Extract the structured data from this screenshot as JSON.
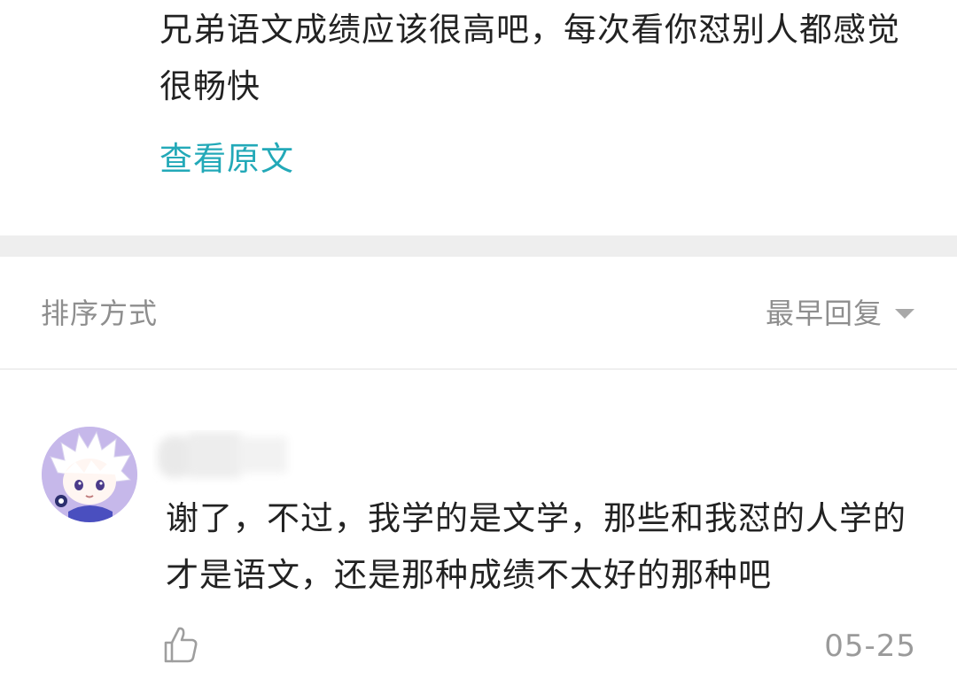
{
  "original_post": {
    "text": "兄弟语文成绩应该很高吧，每次看你怼别人都感觉很畅快",
    "view_original_label": "查看原文"
  },
  "sort": {
    "label": "排序方式",
    "selected": "最早回复",
    "chevron_icon": "chevron-down-icon"
  },
  "reply": {
    "avatar_icon": "user-avatar",
    "username": "",
    "text": "谢了，不过，我学的是文学，那些和我怼的人学的才是语文，还是那种成绩不太好的那种吧",
    "like_icon": "thumbs-up-icon",
    "date": "05-25"
  },
  "colors": {
    "link": "#23a9b8",
    "text": "#222222",
    "muted": "#8e8e8e",
    "divider": "#eeeeee",
    "avatar_bg": "#c6b8ea"
  }
}
